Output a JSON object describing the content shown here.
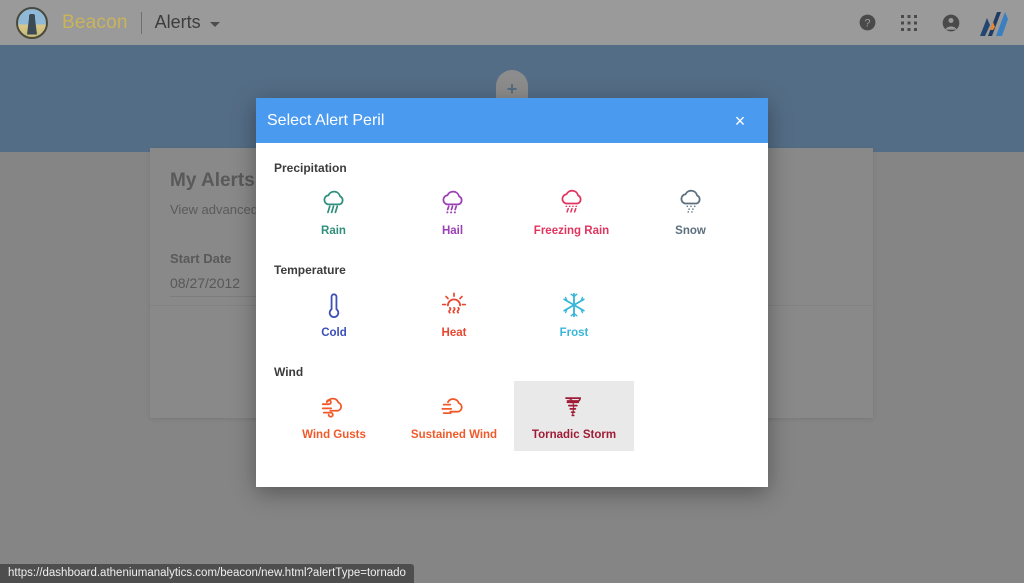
{
  "appbar": {
    "brand": "Beacon",
    "nav_title": "Alerts",
    "logo_icon": "lighthouse-logo",
    "caret_icon": "chevron-down-icon",
    "actions": [
      {
        "name": "help-icon",
        "glyph": "?"
      },
      {
        "name": "apps-grid-icon",
        "glyph": "∷"
      },
      {
        "name": "account-icon",
        "glyph": "●"
      }
    ],
    "company_logo": "athenium-chevron-logo"
  },
  "background_page": {
    "add_alert_button": "+",
    "card": {
      "title": "My Alerts",
      "subtitle": "View advanced alert",
      "start_date_label": "Start Date",
      "start_date_value": "08/27/2012"
    }
  },
  "modal": {
    "title": "Select Alert Peril",
    "close_label": "×",
    "header_color": "#4a9af0",
    "groups": [
      {
        "name": "Precipitation",
        "tiles": [
          {
            "label": "Rain",
            "icon": "rain-cloud-icon",
            "color": "#2f8f7c",
            "selected": false
          },
          {
            "label": "Hail",
            "icon": "hail-cloud-icon",
            "color": "#9b3fb5",
            "selected": false
          },
          {
            "label": "Freezing Rain",
            "icon": "freezing-rain-cloud-icon",
            "color": "#e0355f",
            "selected": false
          },
          {
            "label": "Snow",
            "icon": "snow-cloud-icon",
            "color": "#5c6f7e",
            "selected": false
          }
        ]
      },
      {
        "name": "Temperature",
        "tiles": [
          {
            "label": "Cold",
            "icon": "thermometer-icon",
            "color": "#3a4fb8",
            "selected": false
          },
          {
            "label": "Heat",
            "icon": "sun-heat-icon",
            "color": "#e8462f",
            "selected": false
          },
          {
            "label": "Frost",
            "icon": "snowflake-icon",
            "color": "#39b6da",
            "selected": false
          }
        ]
      },
      {
        "name": "Wind",
        "tiles": [
          {
            "label": "Wind Gusts",
            "icon": "wind-gust-cloud-icon",
            "color": "#f05a2a",
            "selected": false
          },
          {
            "label": "Sustained Wind",
            "icon": "sustained-wind-cloud-icon",
            "color": "#f05a2a",
            "selected": false
          },
          {
            "label": "Tornadic Storm",
            "icon": "tornado-icon",
            "color": "#a01c36",
            "selected": true
          }
        ]
      }
    ]
  },
  "statusbar": {
    "url": "https://dashboard.atheniumanalytics.com/beacon/new.html?alertType=tornado"
  }
}
